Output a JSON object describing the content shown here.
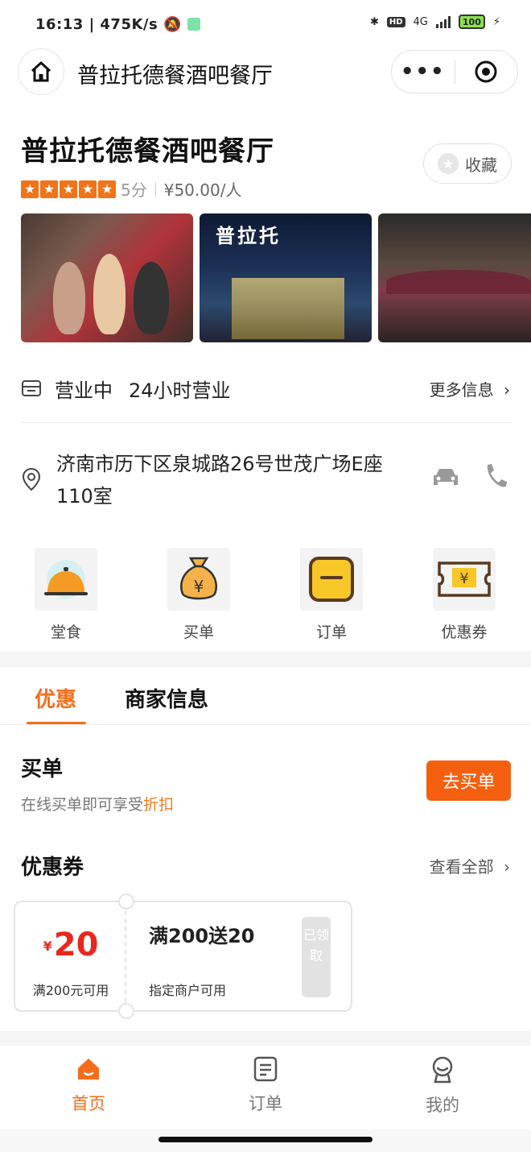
{
  "status": {
    "time": "16:13",
    "speed": "475K/s",
    "network": "4G",
    "battery": "100",
    "hd": "HD"
  },
  "navbar": {
    "title": "普拉托德餐酒吧餐厅",
    "more_label": "•••"
  },
  "shop": {
    "name": "普拉托德餐酒吧餐厅",
    "favorite_label": "收藏",
    "score": "5分",
    "price": "¥50.00/人",
    "rating_stars": 5,
    "photo_sign": "普拉托"
  },
  "hours": {
    "status": "营业中",
    "time": "24小时营业",
    "more_info": "更多信息"
  },
  "address": {
    "text": "济南市历下区泉城路26号世茂广场E座110室"
  },
  "quick_actions": [
    {
      "label": "堂食",
      "icon": "dining-dome-icon"
    },
    {
      "label": "买单",
      "icon": "money-bag-icon"
    },
    {
      "label": "订单",
      "icon": "order-icon"
    },
    {
      "label": "优惠券",
      "icon": "coupon-ticket-icon"
    }
  ],
  "tabs": [
    {
      "label": "优惠",
      "active": true
    },
    {
      "label": "商家信息",
      "active": false
    }
  ],
  "buy": {
    "title": "买单",
    "subtitle_prefix": "在线买单即可享受",
    "subtitle_highlight": "折扣",
    "button": "去买单"
  },
  "coupons": {
    "title": "优惠券",
    "view_all": "查看全部",
    "items": [
      {
        "currency": "¥",
        "amount": "20",
        "condition": "满200元可用",
        "name": "满200送20",
        "scope": "指定商户可用",
        "status": "已领取"
      }
    ]
  },
  "tabbar": [
    {
      "label": "首页",
      "active": true,
      "icon": "home-icon"
    },
    {
      "label": "订单",
      "active": false,
      "icon": "order-icon"
    },
    {
      "label": "我的",
      "active": false,
      "icon": "user-icon"
    }
  ],
  "colors": {
    "accent": "#f46d1b",
    "price_red": "#e8271e",
    "star": "#f27318"
  }
}
